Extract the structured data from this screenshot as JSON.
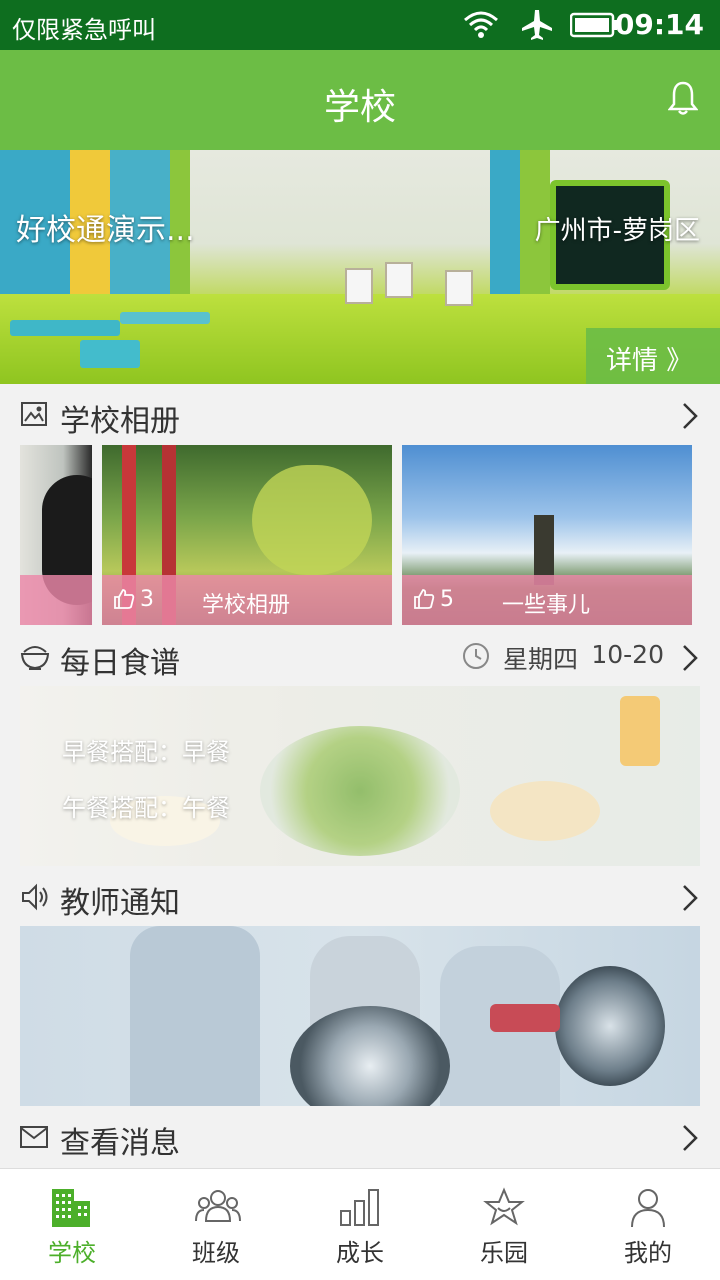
{
  "status_bar": {
    "carrier": "仅限紧急呼叫",
    "time": "09:14",
    "icons": [
      "wifi-icon",
      "airplane-icon",
      "battery-icon"
    ]
  },
  "header": {
    "title": "学校",
    "notification_icon": "bell-icon"
  },
  "hero": {
    "school_name": "好校通演示...",
    "location": "广州市-萝岗区",
    "detail_label": "详情 》"
  },
  "album": {
    "title": "学校相册",
    "icon": "image-icon",
    "cards": [
      {
        "likes": "3",
        "name": "学校相册"
      },
      {
        "likes": "5",
        "name": "一些事儿"
      }
    ]
  },
  "recipe": {
    "title": "每日食谱",
    "icon": "bowl-icon",
    "weekday": "星期四",
    "date": "10-20",
    "breakfast": "早餐搭配：早餐",
    "lunch": "午餐搭配：午餐"
  },
  "notice": {
    "title": "教师通知",
    "icon": "speaker-icon"
  },
  "messages": {
    "title": "查看消息",
    "icon": "mail-icon"
  },
  "nav": {
    "items": [
      {
        "label": "学校",
        "icon": "building-icon",
        "active": true
      },
      {
        "label": "班级",
        "icon": "group-icon"
      },
      {
        "label": "成长",
        "icon": "bar-chart-icon"
      },
      {
        "label": "乐园",
        "icon": "star-icon"
      },
      {
        "label": "我的",
        "icon": "person-icon"
      }
    ]
  },
  "colors": {
    "status_bar": "#0e6e1f",
    "header": "#6cbd45",
    "nav_active": "#4caf2a",
    "album_overlay": "#ec88a8"
  }
}
